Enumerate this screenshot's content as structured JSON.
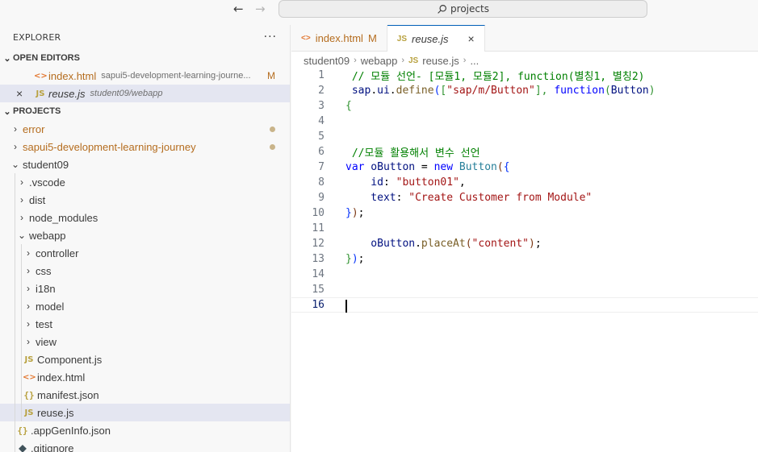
{
  "titlebar": {
    "search_text": "projects"
  },
  "explorer": {
    "title": "EXPLORER",
    "more": "···",
    "open_editors": {
      "label": "OPEN EDITORS",
      "items": [
        {
          "icon": "<>",
          "name": "index.html",
          "desc": "sapui5-development-learning-journe...",
          "badge": "M"
        },
        {
          "icon": "JS",
          "name": "reuse.js",
          "desc": "student09/webapp",
          "close": "×"
        }
      ]
    },
    "projects": {
      "label": "PROJECTS",
      "error": "error",
      "sapui5": "sapui5-development-learning-journey",
      "student09": "student09",
      "vscode": ".vscode",
      "dist": "dist",
      "node_modules": "node_modules",
      "webapp": "webapp",
      "controller": "controller",
      "css": "css",
      "i18n": "i18n",
      "model": "model",
      "test": "test",
      "view": "view",
      "component": "Component.js",
      "index": "index.html",
      "manifest": "manifest.json",
      "reuse": "reuse.js",
      "appgen": ".appGenInfo.json",
      "gitignore": ".gitignore"
    },
    "icons": {
      "js": "JS",
      "html": "<>",
      "json": "{}"
    }
  },
  "tabs": [
    {
      "icon": "<>",
      "label": "index.html",
      "badge": "M"
    },
    {
      "icon": "JS",
      "label": "reuse.js",
      "close": "×"
    }
  ],
  "breadcrumb": {
    "p1": "student09",
    "p2": "webapp",
    "icon": "JS",
    "p3": "reuse.js",
    "p4": "..."
  },
  "code": {
    "line_numbers": [
      "1",
      "2",
      "3",
      "4",
      "5",
      "6",
      "7",
      "8",
      "9",
      "10",
      "11",
      "12",
      "13",
      "14",
      "15",
      "16"
    ],
    "l1": " // 모듈 선언- [모듈1, 모듈2], function(별칭1, 별칭2)",
    "l2_a": " sap",
    "l2_b": ".",
    "l2_c": "ui",
    "l2_d": ".",
    "l2_e": "define",
    "l2_f": "(",
    "l2_g": "[",
    "l2_h": "\"sap/m/Button\"",
    "l2_i": "], ",
    "l2_j": "function",
    "l2_k": "(",
    "l2_l": "Button",
    "l2_m": ")",
    "l3": "{",
    "l6": " //모듈 활용해서 변수 선언",
    "l7_a": "var",
    "l7_b": " oButton",
    "l7_c": " = ",
    "l7_d": "new",
    "l7_e": " Button",
    "l7_f": "(",
    "l7_g": "{",
    "l8_a": "    id",
    "l8_b": ": ",
    "l8_c": "\"button01\"",
    "l8_d": ",",
    "l9_a": "    text",
    "l9_b": ": ",
    "l9_c": "\"Create Customer from Module\"",
    "l10_a": "}",
    "l10_b": ")",
    "l10_c": ";",
    "l12_a": "    oButton",
    "l12_b": ".",
    "l12_c": "placeAt",
    "l12_d": "(",
    "l12_e": "\"content\"",
    "l12_f": ")",
    "l12_g": ";",
    "l13_a": "}",
    "l13_b": ")",
    "l13_c": ";"
  }
}
